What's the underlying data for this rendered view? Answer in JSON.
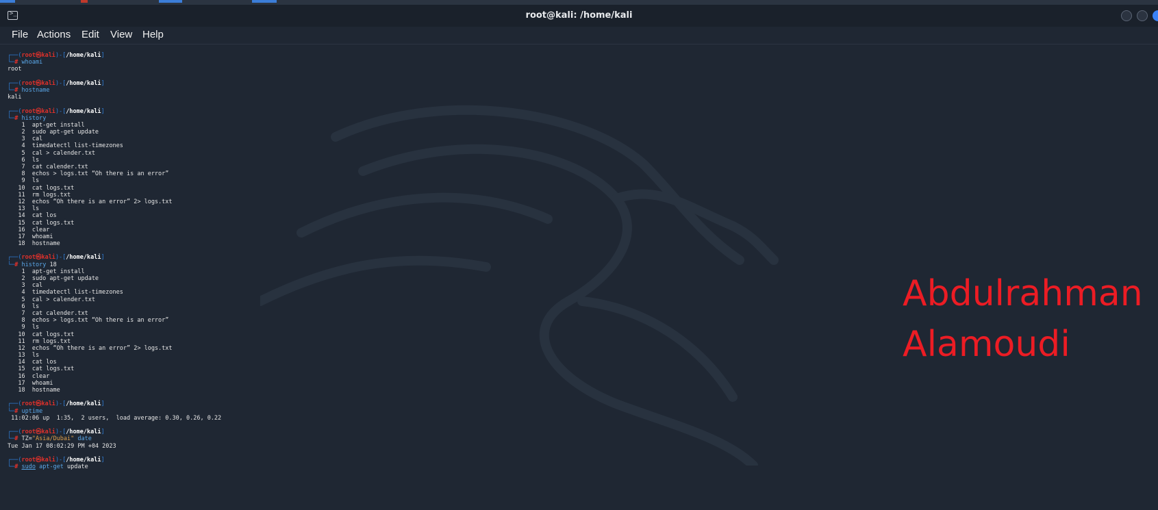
{
  "window": {
    "title": "root@kali: /home/kali"
  },
  "menu": [
    "File",
    "Actions",
    "Edit",
    "View",
    "Help"
  ],
  "prompt": {
    "user": "root",
    "host": "kali",
    "path": "/home/kali",
    "symbol": "#"
  },
  "history_list": [
    "apt-get install",
    "sudo apt-get update",
    "cal",
    "timedatectl list-timezones",
    "cal > calender.txt",
    "ls",
    "cat calender.txt",
    "echos > logs.txt “Oh there is an error”",
    "ls",
    "cat logs.txt",
    "rm logs.txt",
    "echos “Oh there is an error” 2> logs.txt",
    "ls",
    "cat los",
    "cat logs.txt",
    "clear",
    "whoami",
    "hostname"
  ],
  "sessions": [
    {
      "command": [
        {
          "t": "whoami",
          "c": "cmd"
        }
      ],
      "output": [
        "root"
      ]
    },
    {
      "command": [
        {
          "t": "hostname",
          "c": "cmd"
        }
      ],
      "output": [
        "kali"
      ]
    },
    {
      "command": [
        {
          "t": "history",
          "c": "cmd"
        }
      ],
      "output_from": "history_list"
    },
    {
      "command": [
        {
          "t": "history",
          "c": "cmd"
        },
        {
          "t": " 18",
          "c": ""
        }
      ],
      "output_from": "history_list"
    },
    {
      "command": [
        {
          "t": "uptime",
          "c": "cmd"
        }
      ],
      "output": [
        " 11:02:06 up  1:35,  2 users,  load average: 0.30, 0.26, 0.22"
      ]
    },
    {
      "command": [
        {
          "t": "TZ=",
          "c": ""
        },
        {
          "t": "\"Asia/Dubai\"",
          "c": "str"
        },
        {
          "t": " date",
          "c": "cmd"
        }
      ],
      "output": [
        "Tue Jan 17 08:02:29 PM +04 2023"
      ]
    },
    {
      "command": [
        {
          "t": "sudo",
          "c": "cmd under"
        },
        {
          "t": " apt-get",
          "c": "cmd"
        },
        {
          "t": " update",
          "c": ""
        }
      ],
      "output": []
    }
  ],
  "watermark": {
    "line1": "Abdulrahman",
    "line2": "Alamoudi"
  },
  "colors": {
    "background": "#1f2733",
    "prompt_box": "#2f7fd8",
    "prompt_user": "#e0312b",
    "command": "#5aa7e8",
    "string": "#e0a04a",
    "watermark": "#ec1c24"
  }
}
